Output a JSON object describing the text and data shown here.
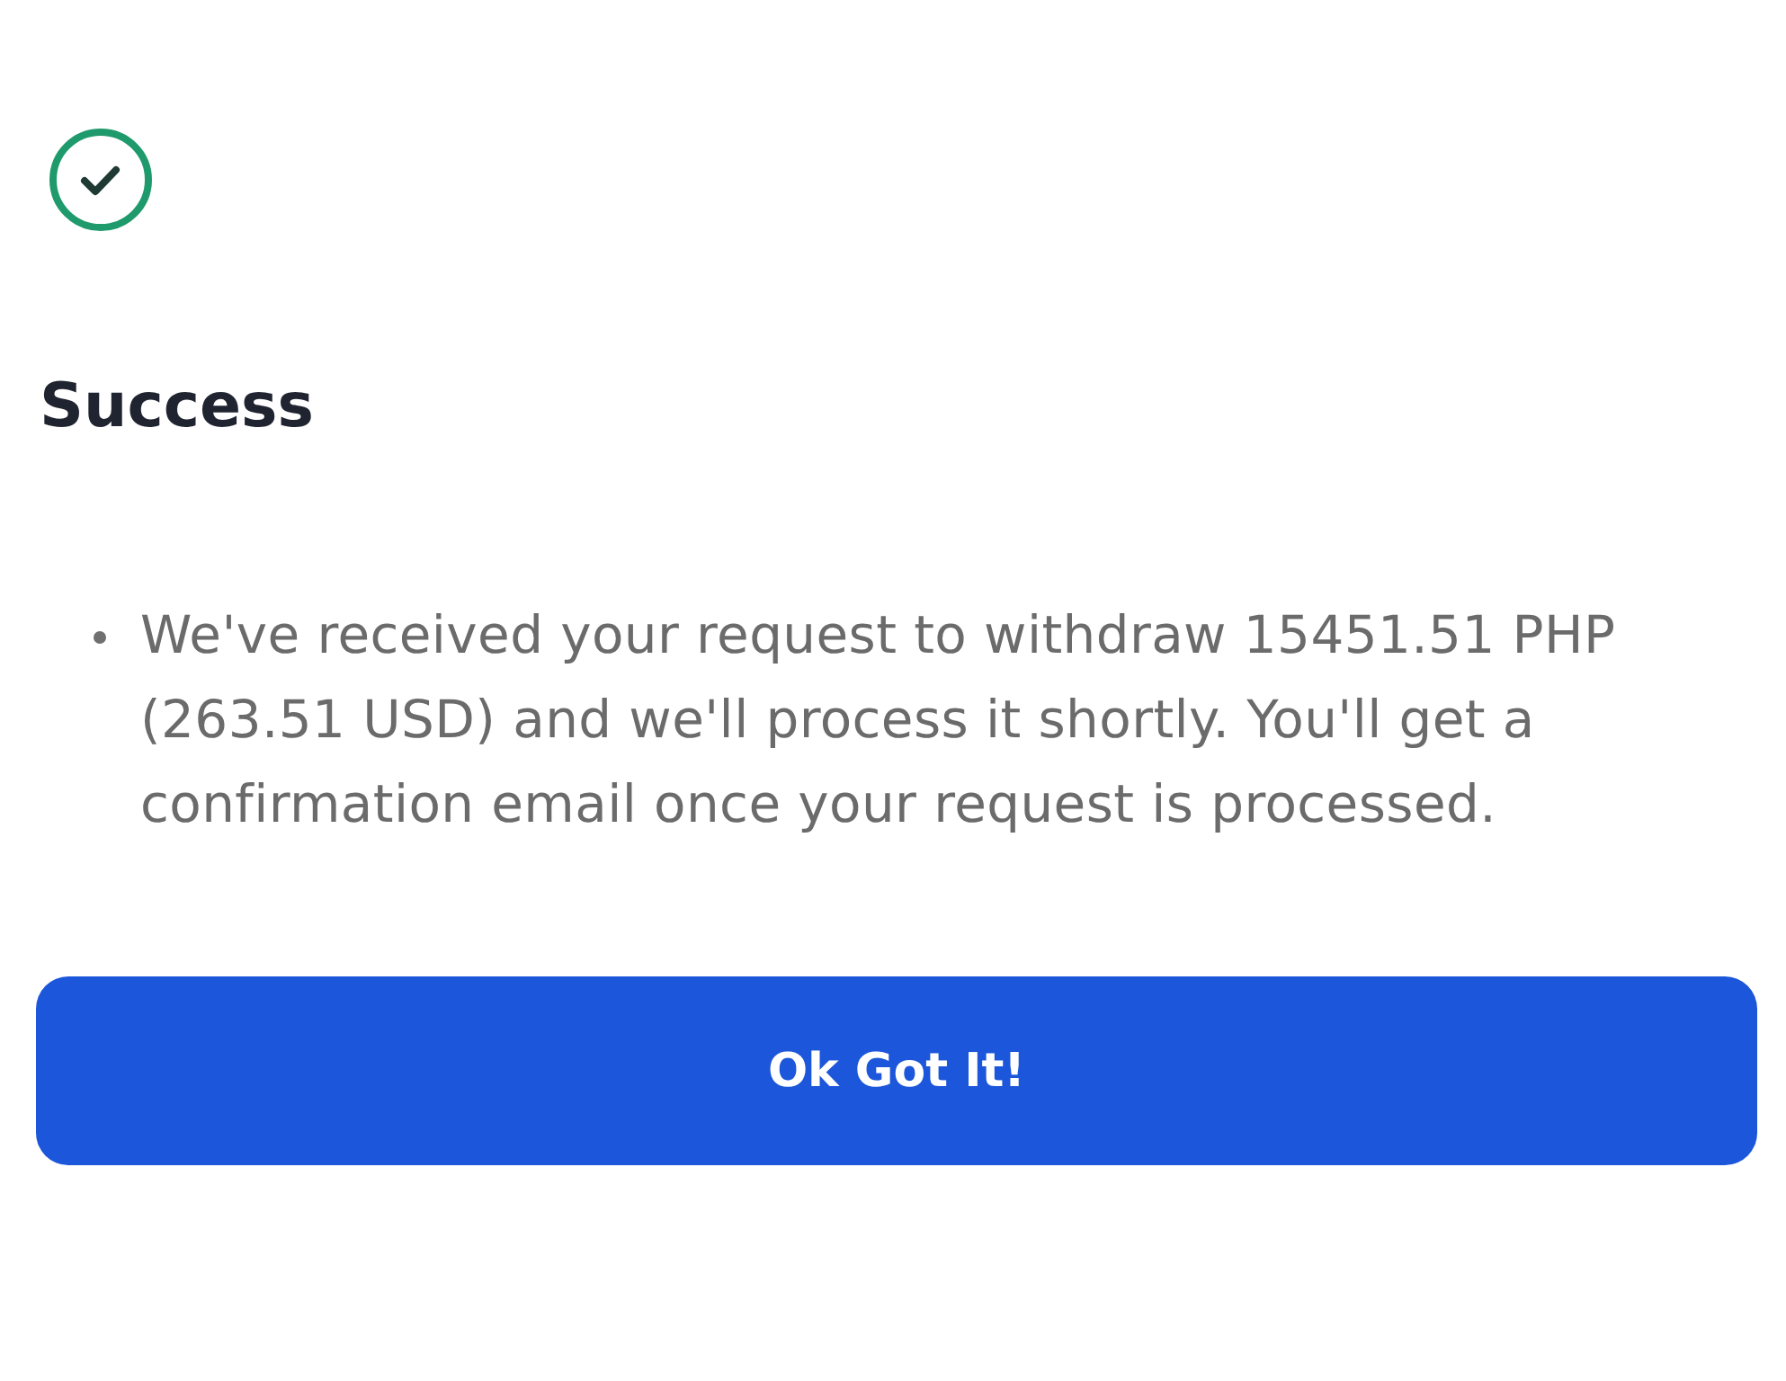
{
  "dialog": {
    "title": "Success",
    "messages": [
      "We've received your request to withdraw 15451.51 PHP (263.51 USD) and we'll process it shortly. You'll get a confirmation email once your request is processed."
    ],
    "button": "Ok Got It!"
  }
}
